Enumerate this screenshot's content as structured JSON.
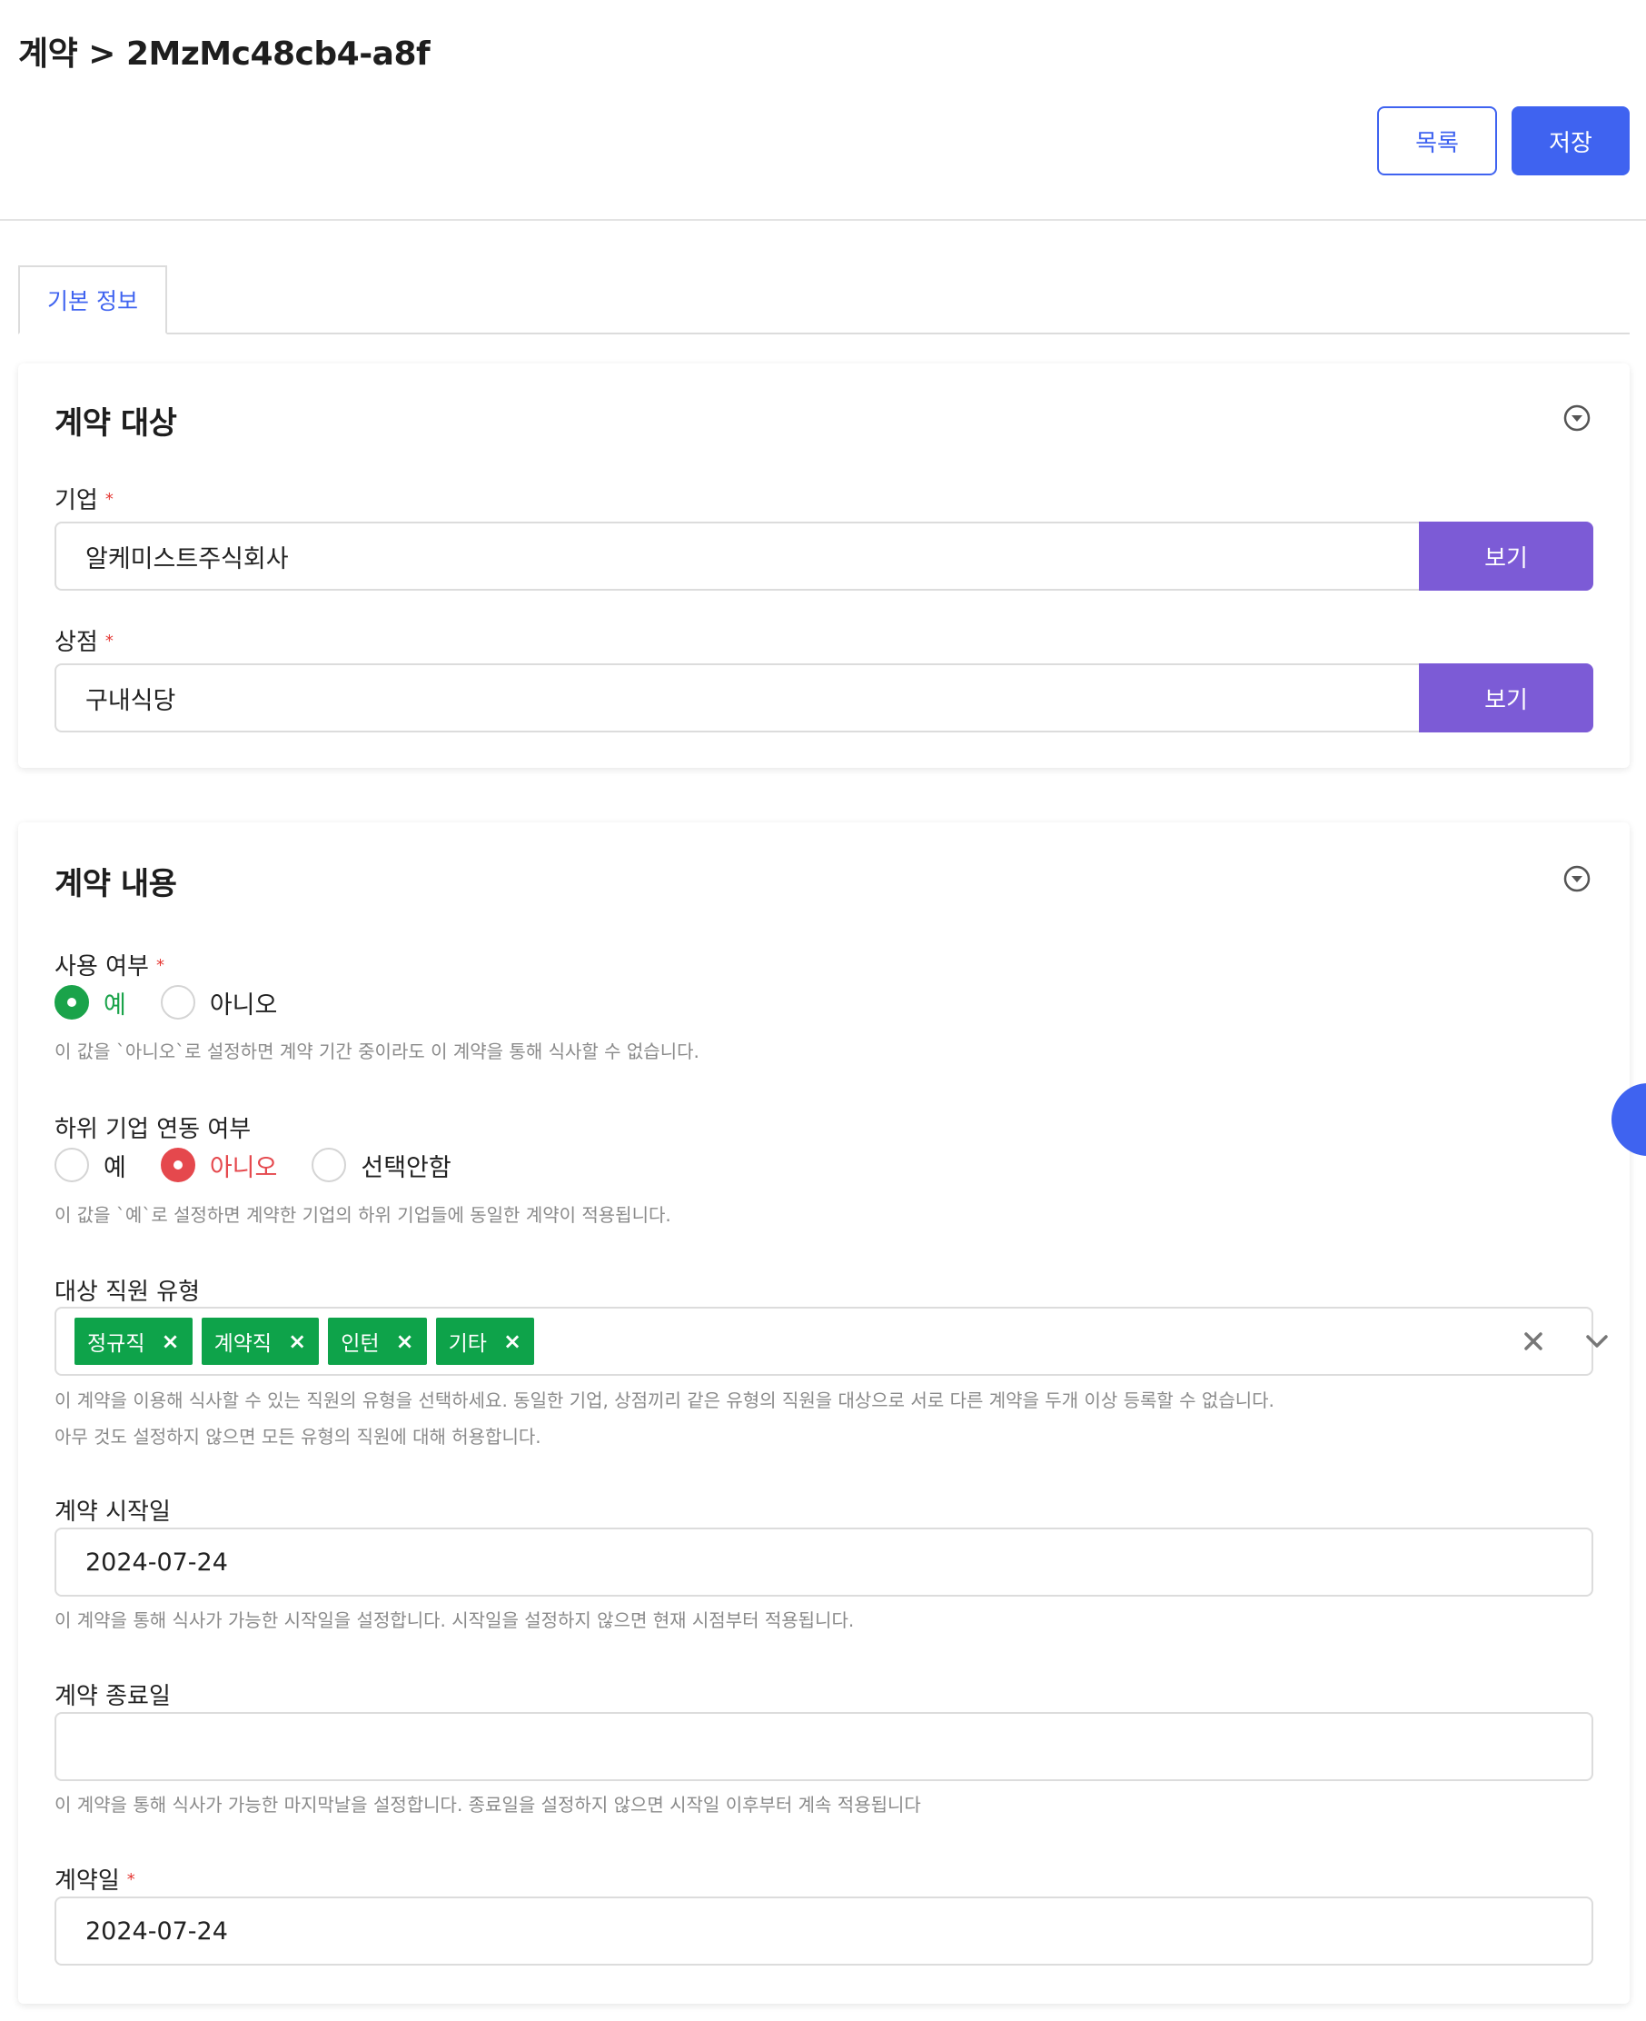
{
  "header": {
    "breadcrumb": "계약 > 2MzMc48cb4-a8f",
    "list_button": "목록",
    "save_button": "저장"
  },
  "tabs": [
    {
      "label": "기본 정보"
    }
  ],
  "colors": {
    "primary": "#3f63f0",
    "view_button": "#7c5bd6",
    "tag": "#0ea34a",
    "radio_yes": "#1aa34a",
    "radio_no": "#e5484d"
  },
  "contract_target": {
    "title": "계약 대상",
    "company": {
      "label": "기업",
      "required_mark": "*",
      "value": "알케미스트주식회사",
      "button": "보기"
    },
    "store": {
      "label": "상점",
      "required_mark": "*",
      "value": "구내식당",
      "button": "보기"
    }
  },
  "contract_content": {
    "title": "계약 내용",
    "use": {
      "label": "사용 여부",
      "required_mark": "*",
      "options": [
        "예",
        "아니오"
      ],
      "selected": "예",
      "help": "이 값을 `아니오`로 설정하면 계약 기간 중이라도 이 계약을 통해 식사할 수 없습니다."
    },
    "sub_company": {
      "label": "하위 기업 연동 여부",
      "options": [
        "예",
        "아니오",
        "선택안함"
      ],
      "selected": "아니오",
      "help": "이 값을 `예`로 설정하면 계약한 기업의 하위 기업들에 동일한 계약이 적용됩니다."
    },
    "employee_types": {
      "label": "대상 직원 유형",
      "tags": [
        "정규직",
        "계약직",
        "인턴",
        "기타"
      ],
      "tag_remove": "×",
      "help1": "이 계약을 이용해 식사할 수 있는 직원의 유형을 선택하세요. 동일한 기업, 상점끼리 같은 유형의 직원을 대상으로 서로 다른 계약을 두개 이상 등록할 수 없습니다.",
      "help2": "아무 것도 설정하지 않으면 모든 유형의 직원에 대해 허용합니다."
    },
    "start_date": {
      "label": "계약 시작일",
      "value": "2024-07-24",
      "help": "이 계약을 통해 식사가 가능한 시작일을 설정합니다. 시작일을 설정하지 않으면 현재 시점부터 적용됩니다."
    },
    "end_date": {
      "label": "계약 종료일",
      "value": "",
      "help": "이 계약을 통해 식사가 가능한 마지막날을 설정합니다. 종료일을 설정하지 않으면 시작일 이후부터 계속 적용됩니다"
    },
    "contract_date": {
      "label": "계약일",
      "required_mark": "*",
      "value": "2024-07-24"
    }
  }
}
